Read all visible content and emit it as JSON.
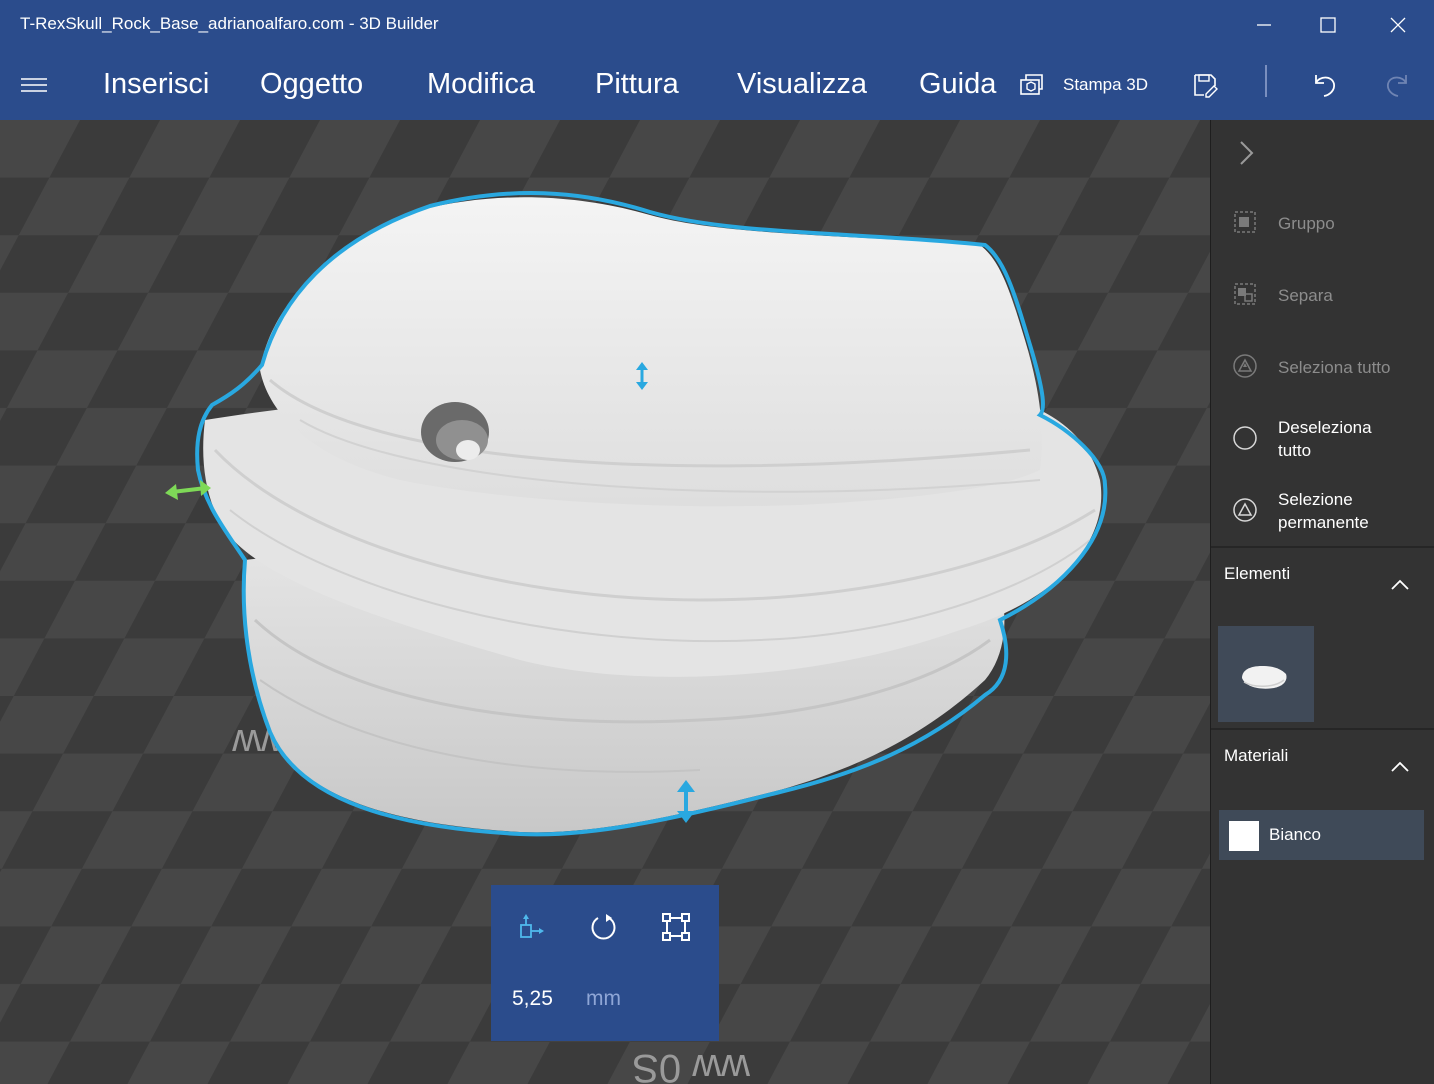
{
  "window": {
    "title": "T-RexSkull_Rock_Base_adrianoalfaro.com - 3D Builder",
    "minimize_icon": "minimize-icon",
    "maximize_icon": "maximize-icon",
    "close_icon": "close-icon"
  },
  "menubar": {
    "items": [
      {
        "label": "Inserisci"
      },
      {
        "label": "Oggetto"
      },
      {
        "label": "Modifica"
      },
      {
        "label": "Pittura"
      },
      {
        "label": "Visualizza"
      },
      {
        "label": "Guida"
      }
    ],
    "print3d_label": "Stampa 3D",
    "icons": [
      "hamburger-icon",
      "print3d-icon",
      "save-icon",
      "undo-icon",
      "redo-icon"
    ]
  },
  "viewport": {
    "grid_labels": [
      "ww",
      "ww 0S"
    ],
    "selection_color": "#29a8e0",
    "handle_x_color": "#7ed957",
    "handle_z_color": "#29a8e0"
  },
  "transform_panel": {
    "value": "5,25",
    "unit": "mm",
    "icons": [
      "move-icon",
      "rotate-icon",
      "scale-icon"
    ]
  },
  "right_panel": {
    "actions": [
      {
        "label": "Gruppo",
        "enabled": false,
        "icon": "group-icon"
      },
      {
        "label": "Separa",
        "enabled": false,
        "icon": "separate-icon"
      },
      {
        "label": "Seleziona tutto",
        "enabled": false,
        "icon": "select-all-icon"
      },
      {
        "label_line1": "Deseleziona",
        "label_line2": "tutto",
        "enabled": true,
        "icon": "deselect-all-icon"
      },
      {
        "label_line1": "Selezione",
        "label_line2": "permanente",
        "enabled": true,
        "icon": "sticky-selection-icon"
      }
    ],
    "elements_title": "Elementi",
    "materials_title": "Materiali",
    "materials": [
      {
        "name": "Bianco",
        "color": "#ffffff"
      }
    ]
  },
  "colors": {
    "accent": "#2b4c8c",
    "selection": "#29a8e0"
  }
}
